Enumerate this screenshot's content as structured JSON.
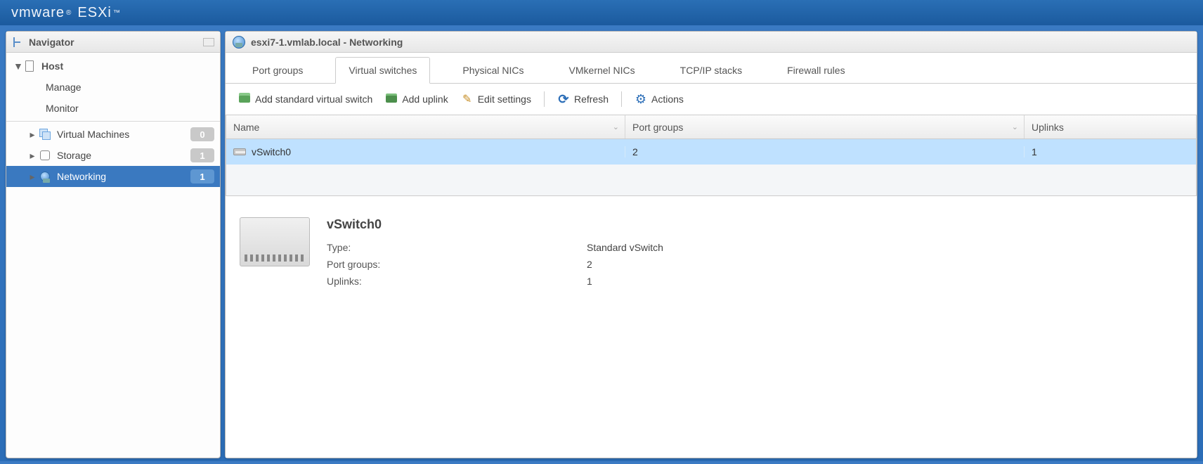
{
  "brand": {
    "vmware": "vmware",
    "product": "ESXi"
  },
  "navigator": {
    "title": "Navigator",
    "host": {
      "label": "Host",
      "children": [
        {
          "label": "Manage"
        },
        {
          "label": "Monitor"
        }
      ]
    },
    "items": [
      {
        "label": "Virtual Machines",
        "badge": "0"
      },
      {
        "label": "Storage",
        "badge": "1"
      },
      {
        "label": "Networking",
        "badge": "1",
        "selected": true
      }
    ]
  },
  "main": {
    "breadcrumb": "esxi7-1.vmlab.local - Networking",
    "tabs": [
      {
        "label": "Port groups"
      },
      {
        "label": "Virtual switches",
        "active": true
      },
      {
        "label": "Physical NICs"
      },
      {
        "label": "VMkernel NICs"
      },
      {
        "label": "TCP/IP stacks"
      },
      {
        "label": "Firewall rules"
      }
    ],
    "toolbar": {
      "add_vswitch": "Add standard virtual switch",
      "add_uplink": "Add uplink",
      "edit_settings": "Edit settings",
      "refresh": "Refresh",
      "actions": "Actions"
    },
    "grid": {
      "headers": {
        "name": "Name",
        "port_groups": "Port groups",
        "uplinks": "Uplinks"
      },
      "rows": [
        {
          "name": "vSwitch0",
          "port_groups": "2",
          "uplinks": "1"
        }
      ]
    },
    "detail": {
      "title": "vSwitch0",
      "rows": [
        {
          "k": "Type:",
          "v": "Standard vSwitch"
        },
        {
          "k": "Port groups:",
          "v": "2"
        },
        {
          "k": "Uplinks:",
          "v": "1"
        }
      ]
    }
  }
}
